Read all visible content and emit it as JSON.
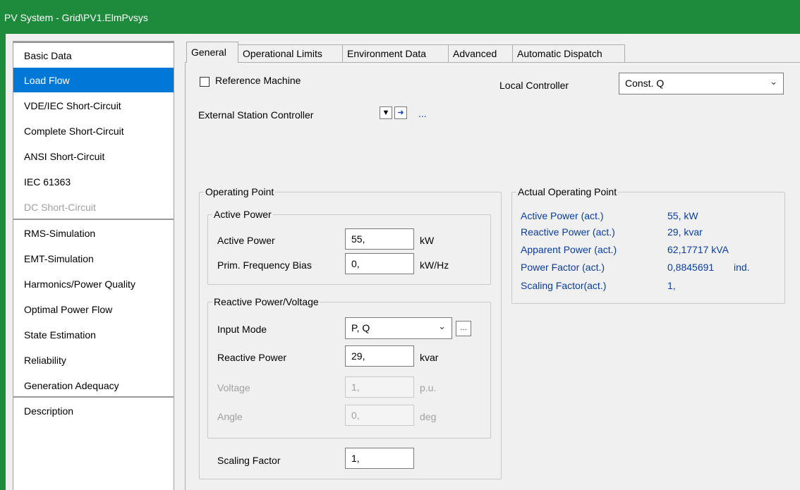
{
  "window": {
    "title": "PV System - Grid\\PV1.ElmPvsys"
  },
  "sidebar": {
    "items": [
      {
        "label": "Basic Data"
      },
      {
        "label": "Load Flow"
      },
      {
        "label": "VDE/IEC Short-Circuit"
      },
      {
        "label": "Complete Short-Circuit"
      },
      {
        "label": "ANSI Short-Circuit"
      },
      {
        "label": "IEC 61363"
      },
      {
        "label": "DC Short-Circuit"
      },
      {
        "label": "RMS-Simulation"
      },
      {
        "label": "EMT-Simulation"
      },
      {
        "label": "Harmonics/Power Quality"
      },
      {
        "label": "Optimal Power Flow"
      },
      {
        "label": "State Estimation"
      },
      {
        "label": "Reliability"
      },
      {
        "label": "Generation Adequacy"
      },
      {
        "label": "Description"
      }
    ],
    "selected": "Load Flow",
    "disabled": [
      "DC Short-Circuit"
    ]
  },
  "tabs": [
    "General",
    "Operational Limits",
    "Environment Data",
    "Advanced",
    "Automatic Dispatch"
  ],
  "active_tab": "General",
  "general": {
    "reference_machine_label": "Reference Machine",
    "reference_machine_checked": false,
    "local_controller_label": "Local Controller",
    "local_controller_value": "Const. Q",
    "external_controller_label": "External Station Controller",
    "ellipsis": "..."
  },
  "operating_point": {
    "title": "Operating Point",
    "active_power_group": {
      "title": "Active Power",
      "active_power_label": "Active Power",
      "active_power_value": "55,",
      "active_power_unit": "kW",
      "freq_bias_label": "Prim. Frequency Bias",
      "freq_bias_value": "0,",
      "freq_bias_unit": "kW/Hz"
    },
    "reactive_group": {
      "title": "Reactive Power/Voltage",
      "input_mode_label": "Input Mode",
      "input_mode_value": "P, Q",
      "input_mode_btn": "...",
      "reactive_power_label": "Reactive Power",
      "reactive_power_value": "29,",
      "reactive_power_unit": "kvar",
      "voltage_label": "Voltage",
      "voltage_value": "1,",
      "voltage_unit": "p.u.",
      "angle_label": "Angle",
      "angle_value": "0,",
      "angle_unit": "deg"
    },
    "scaling_factor_label": "Scaling Factor",
    "scaling_factor_value": "1,"
  },
  "actual_operating_point": {
    "title": "Actual Operating Point",
    "rows": [
      {
        "label": "Active Power (act.)",
        "value": "55, kW",
        "extra": ""
      },
      {
        "label": "Reactive Power (act.)",
        "value": "29, kvar",
        "extra": ""
      },
      {
        "label": "Apparent Power (act.)",
        "value": "62,17717 kVA",
        "extra": ""
      },
      {
        "label": "Power Factor (act.)",
        "value": "0,8845691",
        "extra": "ind."
      },
      {
        "label": "Scaling Factor(act.)",
        "value": "1,",
        "extra": ""
      }
    ]
  },
  "colors": {
    "title_bar": "#1e8a3c",
    "selected": "#0078d7",
    "actual_text": "#0a3c9c"
  }
}
